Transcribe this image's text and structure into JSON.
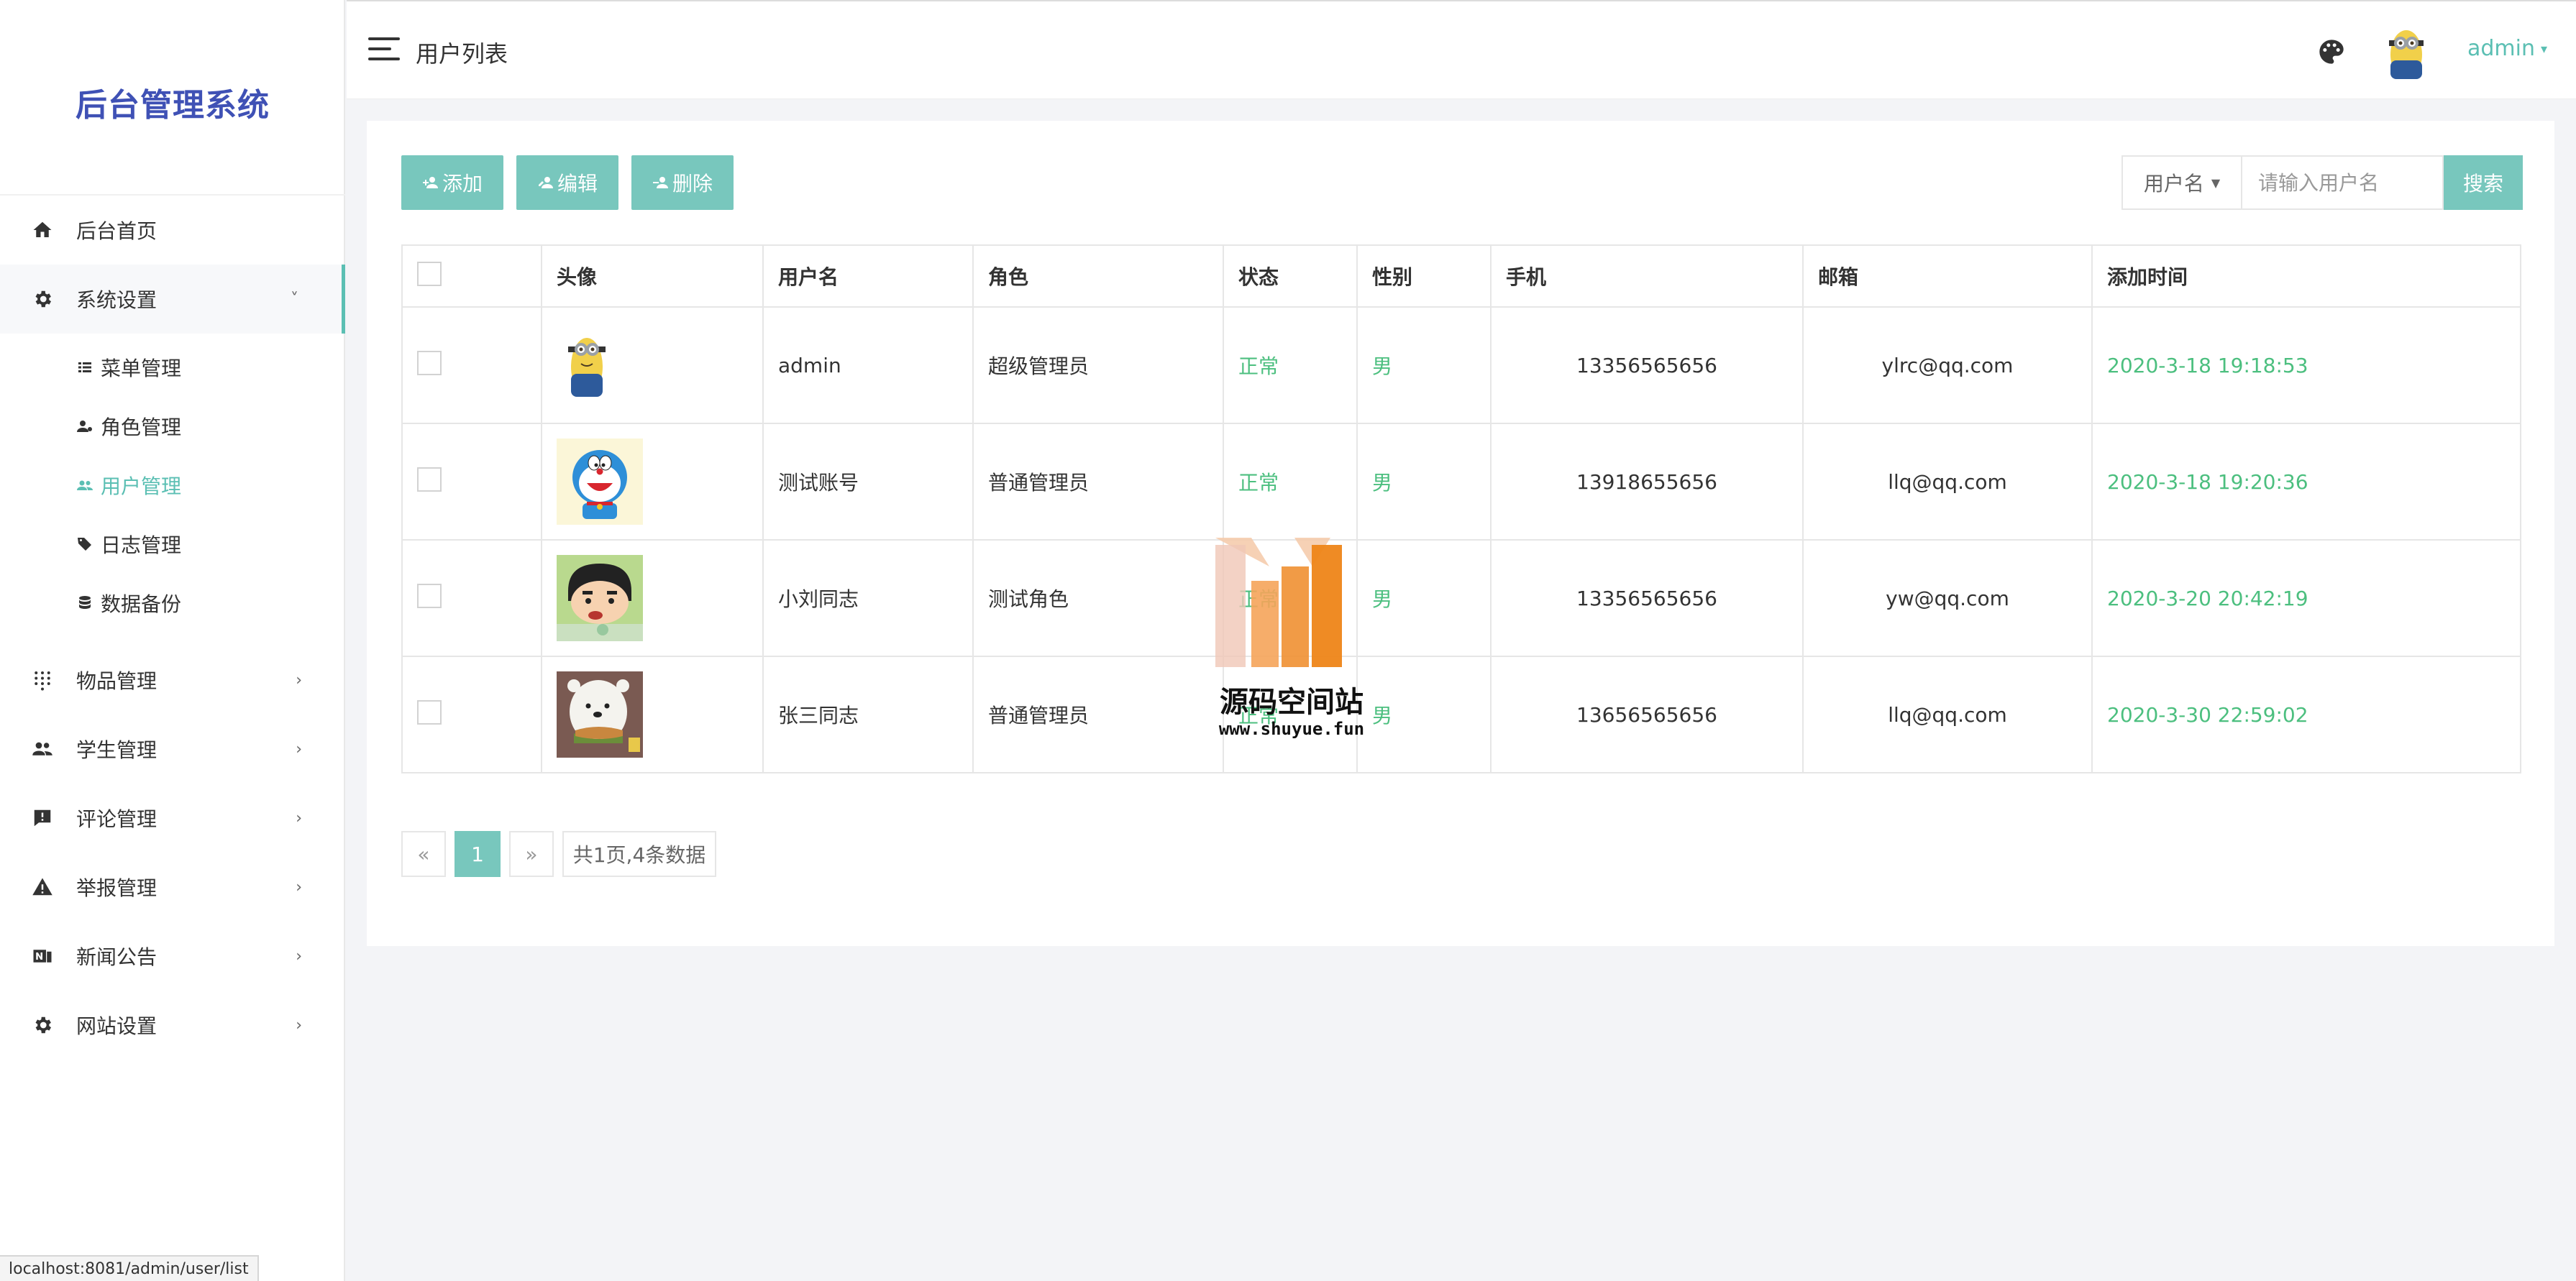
{
  "sidebar": {
    "brand": "后台管理系统",
    "items": [
      {
        "label": "后台首页",
        "icon": "home-icon"
      },
      {
        "label": "系统设置",
        "icon": "gear-icon",
        "expanded": true,
        "children": [
          {
            "label": "菜单管理",
            "icon": "list-icon"
          },
          {
            "label": "角色管理",
            "icon": "user-role-icon"
          },
          {
            "label": "用户管理",
            "icon": "users-icon",
            "active": true
          },
          {
            "label": "日志管理",
            "icon": "tags-icon"
          },
          {
            "label": "数据备份",
            "icon": "database-icon"
          }
        ]
      },
      {
        "label": "物品管理",
        "icon": "grid-dots-icon"
      },
      {
        "label": "学生管理",
        "icon": "people-icon"
      },
      {
        "label": "评论管理",
        "icon": "comment-icon"
      },
      {
        "label": "举报管理",
        "icon": "warning-icon"
      },
      {
        "label": "新闻公告",
        "icon": "news-icon"
      },
      {
        "label": "网站设置",
        "icon": "gear-icon"
      }
    ]
  },
  "header": {
    "title": "用户列表",
    "username": "admin"
  },
  "toolbar": {
    "add_label": "添加",
    "edit_label": "编辑",
    "delete_label": "删除"
  },
  "search": {
    "field_select": "用户名",
    "placeholder": "请输入用户名",
    "button": "搜索"
  },
  "table": {
    "columns": [
      "",
      "头像",
      "用户名",
      "角色",
      "状态",
      "性别",
      "手机",
      "邮箱",
      "添加时间"
    ],
    "rows": [
      {
        "avatar": "minion",
        "username": "admin",
        "role": "超级管理员",
        "status": "正常",
        "gender": "男",
        "phone": "13356565656",
        "email": "ylrc@qq.com",
        "created": "2020-3-18 19:18:53"
      },
      {
        "avatar": "doraemon",
        "username": "测试账号",
        "role": "普通管理员",
        "status": "正常",
        "gender": "男",
        "phone": "13918655656",
        "email": "llq@qq.com",
        "created": "2020-3-18 19:20:36"
      },
      {
        "avatar": "shinchan",
        "username": "小刘同志",
        "role": "测试角色",
        "status": "正常",
        "gender": "男",
        "phone": "13356565656",
        "email": "yw@qq.com",
        "created": "2020-3-20 20:42:19"
      },
      {
        "avatar": "ice-bear",
        "username": "张三同志",
        "role": "普通管理员",
        "status": "正常",
        "gender": "男",
        "phone": "13656565656",
        "email": "llq@qq.com",
        "created": "2020-3-30 22:59:02"
      }
    ]
  },
  "pager": {
    "prev": "«",
    "current": "1",
    "next": "»",
    "info": "共1页,4条数据"
  },
  "watermark": {
    "text": "源码空间站",
    "url": "www.shuyue.fun"
  },
  "statusbar": {
    "url": "localhost:8081/admin/user/list"
  },
  "colors": {
    "accent": "#78c7bd",
    "accent_text": "#5bbfb3",
    "brand": "#3f51b5",
    "status_green": "#4cbf7f"
  }
}
